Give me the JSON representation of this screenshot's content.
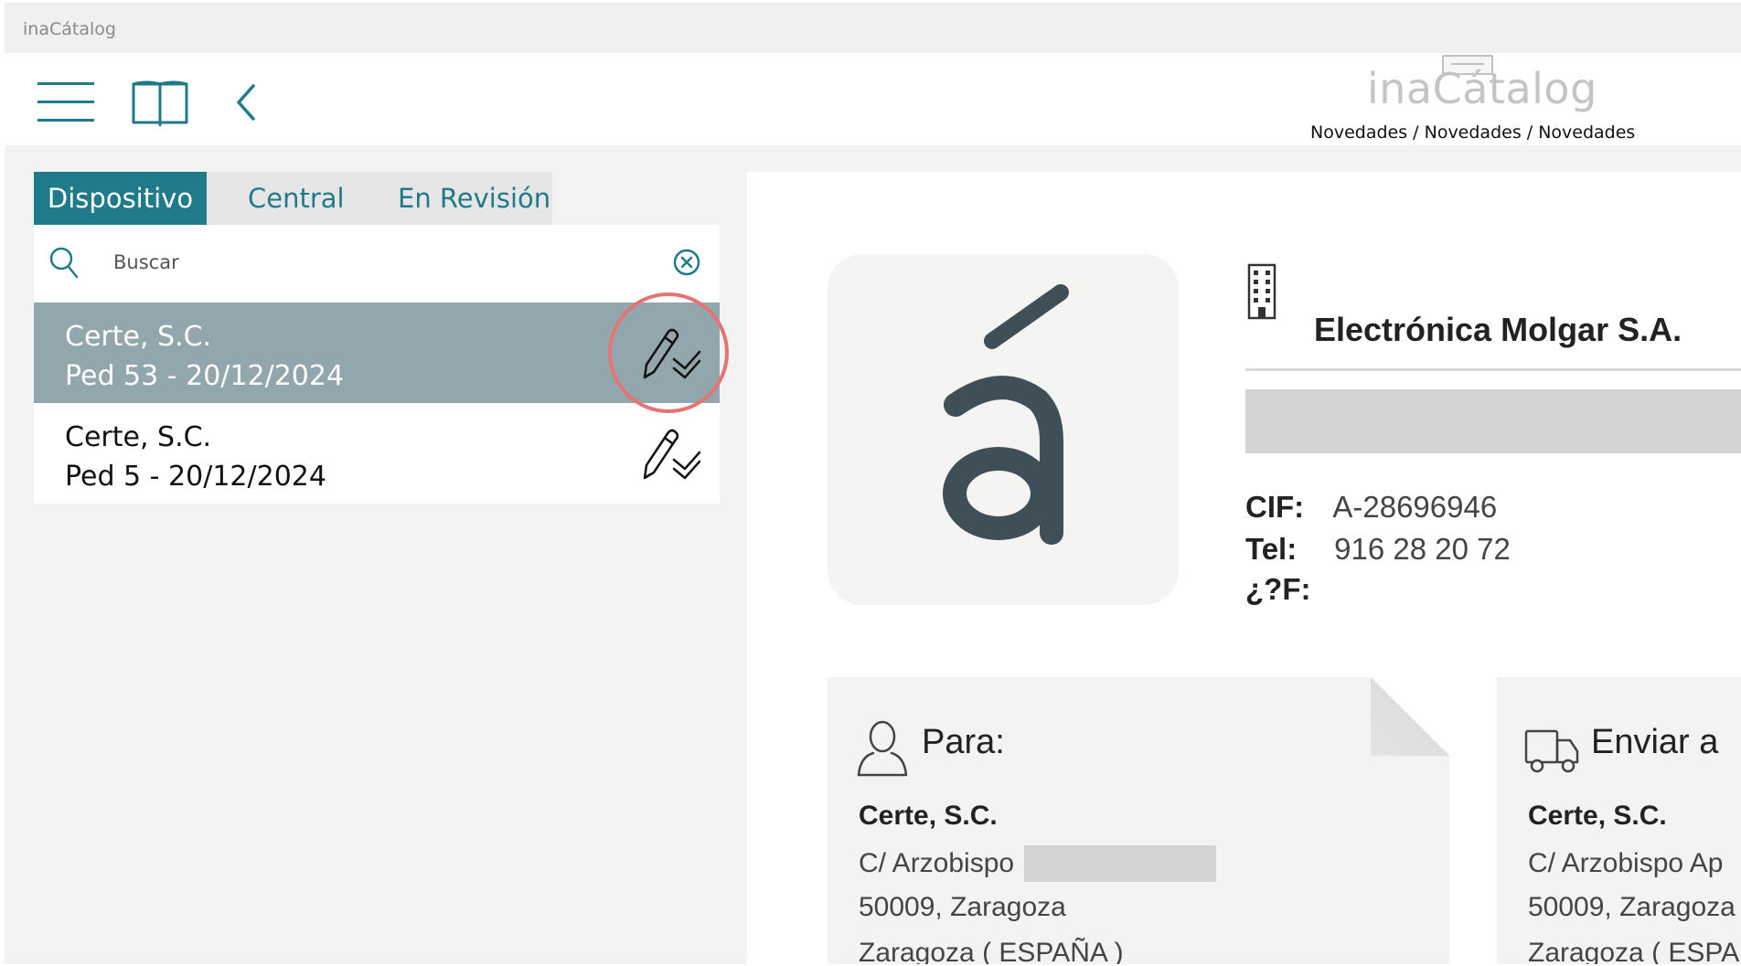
{
  "window": {
    "title": "inaCátalog"
  },
  "header": {
    "logo_text": "inaCátalog",
    "breadcrumb": "Novedades / Novedades / Novedades"
  },
  "tabs": [
    {
      "label": "Dispositivo",
      "active": true
    },
    {
      "label": "Central",
      "active": false
    },
    {
      "label": "En Revisión",
      "active": false
    }
  ],
  "search": {
    "placeholder": "Buscar",
    "value": ""
  },
  "orders": [
    {
      "client": "Certe, S.C.",
      "ref": "Ped 53 - 20/12/2024",
      "selected": true,
      "icon": "sign-check-icon"
    },
    {
      "client": "Certe, S.C.",
      "ref": "Ped 5 - 20/12/2024",
      "selected": false,
      "icon": "sign-check-icon"
    }
  ],
  "company": {
    "logo_letter": "á",
    "name": "Electrónica Molgar S.A.",
    "cif_label": "CIF:",
    "cif_value": "A-28696946",
    "tel_label": "Tel:",
    "tel_value": "916 28 20 72",
    "fax_label": "¿?F:",
    "fax_value": ""
  },
  "bill_to": {
    "title": "Para:",
    "name": "Certe, S.C.",
    "address1": "C/ Arzobispo",
    "address2": "50009, Zaragoza",
    "address3": "Zaragoza ( ESPAÑA )"
  },
  "ship_to": {
    "title": "Enviar a",
    "name": "Certe, S.C.",
    "address1": "C/ Arzobispo Ap",
    "address2": "50009, Zaragoza",
    "address3": "Zaragoza ( ESPA"
  },
  "colors": {
    "accent": "#1f7a89",
    "selected_row": "#91a6ad",
    "highlight_ring": "#e57373",
    "logo_letter": "#3e4f57"
  }
}
